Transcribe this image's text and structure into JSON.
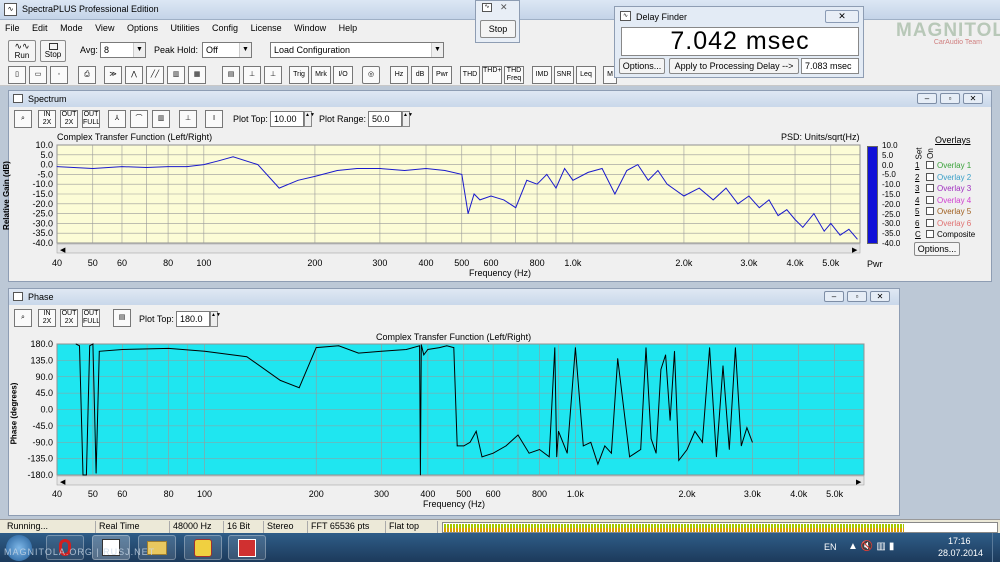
{
  "app": {
    "title": "SpectraPLUS Professional Edition"
  },
  "menu": [
    "File",
    "Edit",
    "Mode",
    "View",
    "Options",
    "Utilities",
    "Config",
    "License",
    "Window",
    "Help"
  ],
  "toolbar": {
    "run": "Run",
    "stop": "Stop",
    "avg_label": "Avg:",
    "avg_value": "8",
    "peak_label": "Peak Hold:",
    "peak_value": "Off",
    "config_value": "Load Configuration",
    "tool_buttons": [
      "Hz",
      "dB",
      "Pwr",
      "THD",
      "THD+N",
      "THD Freq",
      "IMD",
      "SNR",
      "Leq",
      "M"
    ],
    "trig": "Trig",
    "mrk": "Mrk",
    "io": "I/O"
  },
  "stop_dialog": {
    "button": "Stop",
    "icon": "stop-window-icon"
  },
  "delay_finder": {
    "title": "Delay Finder",
    "value": "7.042 msec",
    "options": "Options...",
    "apply": "Apply to Processing Delay -->",
    "applied": "7.083 msec"
  },
  "watermark": {
    "line1": "MAGNITOLA",
    "line2": "CarAudio Team"
  },
  "spectrum": {
    "title": "Spectrum",
    "plot_top_label": "Plot Top:",
    "plot_top": "10.00",
    "plot_range_label": "Plot Range:",
    "plot_range": "50.0",
    "chart_title": "Complex Transfer Function (Left/Right)",
    "psd": "PSD: Units/sqrt(Hz)",
    "ylabel": "Relative Gain (dB)",
    "xlabel": "Frequency (Hz)",
    "pwr": "Pwr",
    "colorbar_ticks": [
      "10.0",
      "5.0",
      "0.0",
      "-5.0",
      "-10.0",
      "-15.0",
      "-20.0",
      "-25.0",
      "-30.0",
      "-35.0",
      "-40.0"
    ],
    "overlays": {
      "title": "Overlays",
      "set": "Set",
      "on": "On",
      "items": [
        {
          "key": "1",
          "name": "Overlay 1",
          "color": "#3aa23a"
        },
        {
          "key": "2",
          "name": "Overlay 2",
          "color": "#3aa0c8"
        },
        {
          "key": "3",
          "name": "Overlay 3",
          "color": "#a030c0"
        },
        {
          "key": "4",
          "name": "Overlay 4",
          "color": "#d040d0"
        },
        {
          "key": "5",
          "name": "Overlay 5",
          "color": "#a06020"
        },
        {
          "key": "6",
          "name": "Overlay 6",
          "color": "#e07070"
        },
        {
          "key": "C",
          "name": "Composite",
          "color": "#000000"
        }
      ],
      "options": "Options..."
    }
  },
  "phase": {
    "title": "Phase",
    "plot_top_label": "Plot Top:",
    "plot_top": "180.0",
    "chart_title": "Complex Transfer Function (Left/Right)",
    "ylabel": "Phase (degrees)",
    "xlabel": "Frequency (Hz)"
  },
  "chart_data": [
    {
      "type": "line",
      "title": "Complex Transfer Function (Left/Right)",
      "xlabel": "Frequency (Hz)",
      "ylabel": "Relative Gain (dB)",
      "x_scale": "log",
      "xlim": [
        40,
        6000
      ],
      "ylim": [
        -40,
        10
      ],
      "x_ticks": [
        {
          "v": 40,
          "t": "40"
        },
        {
          "v": 50,
          "t": "50"
        },
        {
          "v": 60,
          "t": "60"
        },
        {
          "v": 80,
          "t": "80"
        },
        {
          "v": 100,
          "t": "100"
        },
        {
          "v": 200,
          "t": "200"
        },
        {
          "v": 300,
          "t": "300"
        },
        {
          "v": 400,
          "t": "400"
        },
        {
          "v": 500,
          "t": "500"
        },
        {
          "v": 600,
          "t": "600"
        },
        {
          "v": 800,
          "t": "800"
        },
        {
          "v": 1000,
          "t": "1.0k"
        },
        {
          "v": 2000,
          "t": "2.0k"
        },
        {
          "v": 3000,
          "t": "3.0k"
        },
        {
          "v": 4000,
          "t": "4.0k"
        },
        {
          "v": 5000,
          "t": "5.0k"
        }
      ],
      "y_ticks": [
        "10.0",
        "5.0",
        "0.0",
        "-5.0",
        "-10.0",
        "-15.0",
        "-20.0",
        "-25.0",
        "-30.0",
        "-35.0",
        "-40.0"
      ],
      "color": "#1a1acc",
      "x": [
        40,
        50,
        60,
        70,
        80,
        90,
        100,
        110,
        120,
        140,
        160,
        180,
        200,
        230,
        260,
        300,
        350,
        400,
        450,
        500,
        520,
        540,
        560,
        600,
        650,
        700,
        750,
        800,
        850,
        900,
        950,
        1000,
        1100,
        1200,
        1300,
        1400,
        1500,
        1600,
        1700,
        1800,
        2000,
        2200,
        2400,
        2600,
        2800,
        3000,
        3200,
        3400,
        3600,
        3800,
        4000,
        4200,
        4500,
        4800,
        5000,
        5300,
        5600,
        5900
      ],
      "y": [
        -1,
        -2,
        -1,
        -1.5,
        -1,
        -1,
        0,
        2,
        4,
        0,
        -12,
        -8,
        -6,
        -3,
        -2,
        -2,
        -3,
        -2,
        -3,
        -5,
        -25,
        -15,
        -18,
        -16,
        -18,
        -22,
        -8,
        -10,
        -5,
        -12,
        -2,
        -8,
        -4,
        -2,
        -15,
        -3,
        0,
        -8,
        -3,
        -10,
        -16,
        -12,
        -18,
        -12,
        -20,
        -16,
        -22,
        -18,
        -26,
        -23,
        -28,
        -32,
        -25,
        -34,
        -30,
        -36,
        -33,
        -38
      ]
    },
    {
      "type": "line",
      "title": "Complex Transfer Function (Left/Right)",
      "xlabel": "Frequency (Hz)",
      "ylabel": "Phase (degrees)",
      "x_scale": "log",
      "xlim": [
        40,
        6000
      ],
      "ylim": [
        -180,
        180
      ],
      "x_ticks": [
        {
          "v": 40,
          "t": "40"
        },
        {
          "v": 50,
          "t": "50"
        },
        {
          "v": 60,
          "t": "60"
        },
        {
          "v": 80,
          "t": "80"
        },
        {
          "v": 100,
          "t": "100"
        },
        {
          "v": 200,
          "t": "200"
        },
        {
          "v": 300,
          "t": "300"
        },
        {
          "v": 400,
          "t": "400"
        },
        {
          "v": 500,
          "t": "500"
        },
        {
          "v": 600,
          "t": "600"
        },
        {
          "v": 800,
          "t": "800"
        },
        {
          "v": 1000,
          "t": "1.0k"
        },
        {
          "v": 2000,
          "t": "2.0k"
        },
        {
          "v": 3000,
          "t": "3.0k"
        },
        {
          "v": 4000,
          "t": "4.0k"
        },
        {
          "v": 5000,
          "t": "5.0k"
        }
      ],
      "y_ticks": [
        "180.0",
        "135.0",
        "90.0",
        "45.0",
        "0.0",
        "-45.0",
        "-90.0",
        "-135.0",
        "-180.0"
      ],
      "color": "#000000",
      "x": [
        45,
        46,
        47,
        48,
        49,
        50,
        51,
        52,
        60,
        80,
        100,
        130,
        160,
        180,
        200,
        230,
        260,
        300,
        350,
        380,
        382,
        384,
        390,
        400,
        430,
        450,
        470,
        480,
        500,
        520,
        540,
        560,
        600,
        650,
        700,
        750,
        800,
        850,
        880,
        890,
        900,
        950,
        1000,
        1050,
        1100,
        1150,
        1200,
        1250,
        1300,
        1400,
        1500,
        1550,
        1600,
        1650,
        1700,
        1750,
        1800,
        1850,
        1900,
        2000,
        2100,
        2200,
        2300,
        2400,
        2500,
        2600,
        2700,
        2800,
        2900,
        3000
      ],
      "y": [
        180,
        175,
        -180,
        -180,
        175,
        180,
        -175,
        160,
        165,
        168,
        160,
        145,
        80,
        60,
        170,
        175,
        155,
        160,
        165,
        175,
        -180,
        178,
        150,
        165,
        170,
        175,
        170,
        -100,
        -100,
        -90,
        -60,
        -130,
        -120,
        -100,
        -70,
        -120,
        -110,
        -130,
        170,
        -130,
        -60,
        -120,
        170,
        -100,
        -90,
        -150,
        -100,
        -120,
        140,
        -130,
        -110,
        170,
        -80,
        -120,
        110,
        150,
        -30,
        160,
        -140,
        -110,
        -60,
        -90,
        170,
        -130,
        120,
        -110,
        170,
        -100,
        -50,
        -90
      ]
    }
  ],
  "status": {
    "running": "Running...",
    "mode": "Real Time",
    "rate": "48000 Hz",
    "bits": "16 Bit",
    "channels": "Stereo",
    "fft": "FFT 65536 pts",
    "window": "Flat top"
  },
  "taskbar": {
    "lang": "EN",
    "time": "17:16",
    "date": "28.07.2014",
    "watermark": "MAGNITOLA.ORG | RUSJ.NET"
  },
  "colors": {
    "spectrum_bg": "#fcfcd6",
    "phase_bg": "#1fe6f0",
    "spectrum_line": "#1a1acc",
    "phase_line": "#000000",
    "colorbar": "#1010d8",
    "meter": "#a8c800"
  }
}
